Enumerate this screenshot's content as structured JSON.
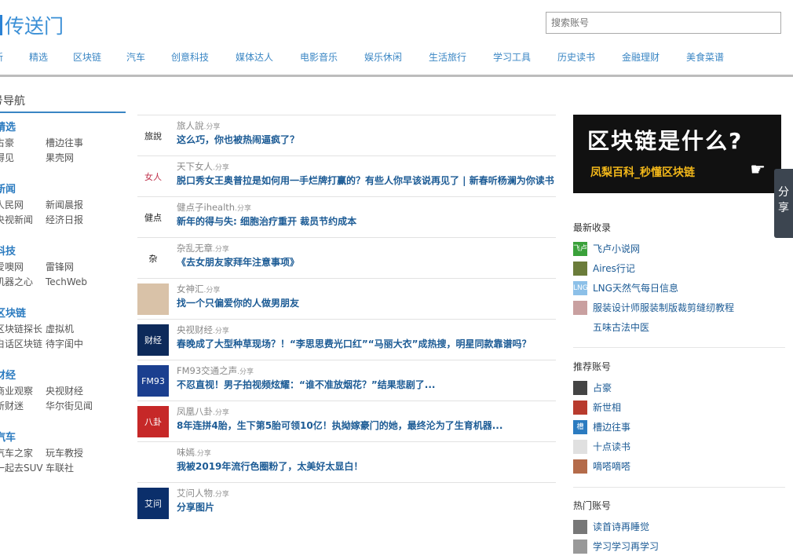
{
  "brand": {
    "logo_text": "传送门"
  },
  "search": {
    "placeholder": "搜索账号"
  },
  "nav": [
    "新",
    "精选",
    "区块链",
    "汽车",
    "创意科技",
    "媒体达人",
    "电影音乐",
    "娱乐休闲",
    "生活旅行",
    "学习工具",
    "历史读书",
    "金融理财",
    "美食菜谱"
  ],
  "sidebar": {
    "title": "号导航",
    "categories": [
      {
        "title": "精选",
        "links": [
          "占豪",
          "槽边往事",
          "得见",
          "果壳网"
        ]
      },
      {
        "title": "新闻",
        "links": [
          "人民网",
          "新闻晨报",
          "央视新闻",
          "经济日报"
        ]
      },
      {
        "title": "科技",
        "links": [
          "爱噢网",
          "雷锋网",
          "机器之心",
          "TechWeb"
        ]
      },
      {
        "title": "区块链",
        "links": [
          "区块链探长",
          "虚拟机",
          "白话区块链",
          "待字闺中"
        ]
      },
      {
        "title": "财经",
        "links": [
          "商业观察",
          "央视财经",
          "新财迷",
          "华尔街见闻"
        ]
      },
      {
        "title": "汽车",
        "links": [
          "汽车之家",
          "玩车教授",
          "一起去SUV",
          "车联社"
        ]
      }
    ]
  },
  "feed": [
    {
      "source": "旅人說",
      "tag": "分享",
      "title": "这么巧，你也被热闹逼疯了？",
      "thumb": "旅說",
      "thumb_bg": "#ffffff",
      "thumb_fg": "#222222"
    },
    {
      "source": "天下女人",
      "tag": "分享",
      "title": "脱口秀女王奥普拉是如何用一手烂牌打赢的？有些人你早该说再见了 | 新春听杨澜为你读书",
      "thumb": "女人",
      "thumb_bg": "#ffffff",
      "thumb_fg": "#c0334d"
    },
    {
      "source": "健点子ihealth",
      "tag": "分享",
      "title": "新年的得与失: 细胞治疗重开 裁员节约成本",
      "thumb": "健点",
      "thumb_bg": "#ffffff",
      "thumb_fg": "#222222"
    },
    {
      "source": "杂乱无章",
      "tag": "分享",
      "title": "《去女朋友家拜年注意事项》",
      "thumb": "杂",
      "thumb_bg": "#ffffff",
      "thumb_fg": "#111111"
    },
    {
      "source": "女神汇",
      "tag": "分享",
      "title": "找一个只偏爱你的人做男朋友",
      "thumb": "",
      "thumb_bg": "#d9c2a8",
      "thumb_fg": "#ffffff"
    },
    {
      "source": "央视财经",
      "tag": "分享",
      "title": "春晚成了大型种草现场？！“李思思费光口红”“马丽大衣”成热搜，明星同款靠谱吗？",
      "thumb": "财经",
      "thumb_bg": "#0d2a5a",
      "thumb_fg": "#ffffff"
    },
    {
      "source": "FM93交通之声",
      "tag": "分享",
      "title": "不忍直视！男子拍视频炫耀：“谁不准放烟花？”结果悲剧了...",
      "thumb": "FM93",
      "thumb_bg": "#1b3f8f",
      "thumb_fg": "#ffffff"
    },
    {
      "source": "凤凰八卦",
      "tag": "分享",
      "title": "8年连拼4胎，生下第5胎可领10亿！执拗嫁豪门的她，最终沦为了生育机器...",
      "thumb": "八卦",
      "thumb_bg": "#c62828",
      "thumb_fg": "#ffffff"
    },
    {
      "source": "味嫣",
      "tag": "分享",
      "title": "我被2019年流行色圈粉了，太美好太显白！",
      "thumb": "",
      "thumb_bg": "#ffffff",
      "thumb_fg": "#111111"
    },
    {
      "source": "艾问人物",
      "tag": "分享",
      "title": "分享图片",
      "thumb": "艾问",
      "thumb_bg": "#0b2f6b",
      "thumb_fg": "#ffffff"
    }
  ],
  "ad": {
    "headline": "区块链是什么?",
    "subline": "凤梨百科_秒懂区块链",
    "hand_icon": "pointing-hand-icon"
  },
  "share_tab": {
    "label": "分享"
  },
  "latest": {
    "title": "最新收录",
    "items": [
      {
        "name": "飞卢小说网",
        "icon_bg": "#3aa13a",
        "icon_text": "飞卢"
      },
      {
        "name": "Aires行记",
        "icon_bg": "#6b7c3a",
        "icon_text": ""
      },
      {
        "name": "LNG天然气每日信息",
        "icon_bg": "#8cc0e8",
        "icon_text": "LNG"
      },
      {
        "name": "服装设计师服装制版裁剪缝纫教程",
        "icon_bg": "#c9a0a0",
        "icon_text": ""
      },
      {
        "name": "五味古法中医",
        "icon_bg": "#ffffff",
        "icon_text": ""
      }
    ]
  },
  "recommended": {
    "title": "推荐账号",
    "items": [
      {
        "name": "占豪",
        "icon_bg": "#444444",
        "icon_text": ""
      },
      {
        "name": "新世相",
        "icon_bg": "#b83b2e",
        "icon_text": ""
      },
      {
        "name": "槽边往事",
        "icon_bg": "#2b7bc0",
        "icon_text": "槽"
      },
      {
        "name": "十点读书",
        "icon_bg": "#e0e0e0",
        "icon_text": ""
      },
      {
        "name": "嘀嗒嘀嗒",
        "icon_bg": "#b46b4a",
        "icon_text": ""
      }
    ]
  },
  "popular": {
    "title": "热门账号",
    "items": [
      {
        "name": "读首诗再睡觉",
        "icon_bg": "#777777",
        "icon_text": ""
      },
      {
        "name": "学习学习再学习",
        "icon_bg": "#999999",
        "icon_text": ""
      }
    ]
  }
}
